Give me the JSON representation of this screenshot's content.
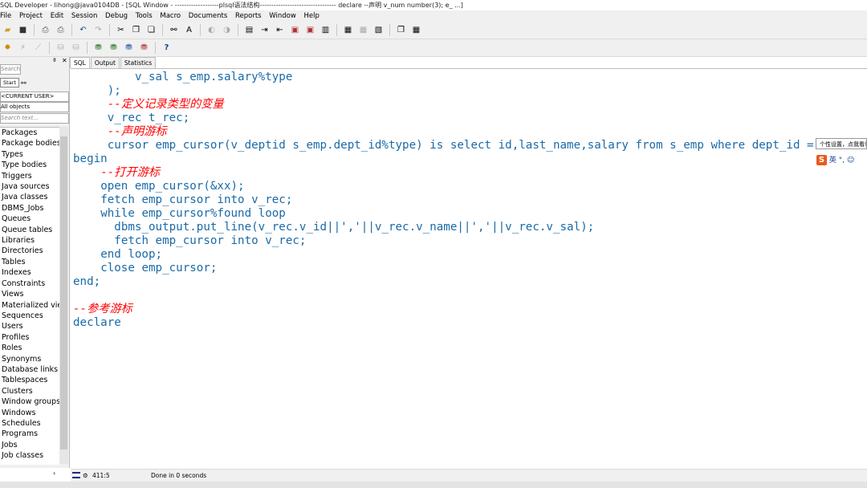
{
  "window": {
    "title": "SQL Developer - lihong@java0104DB - [SQL Window - -------------------plsql语法结构--------------------------------- declare --声明 v_num number(3); e_ ...]"
  },
  "menu": [
    "File",
    "Project",
    "Edit",
    "Session",
    "Debug",
    "Tools",
    "Macro",
    "Documents",
    "Reports",
    "Window",
    "Help"
  ],
  "left_panel": {
    "search_placeholder": "Search text...",
    "start_label": "Start",
    "user_combo": "<CURRENT USER>",
    "type_combo": "All objects",
    "object_types": [
      "Packages",
      "Package bodies",
      "Types",
      "Type bodies",
      "Triggers",
      "Java sources",
      "Java classes",
      "DBMS_Jobs",
      "Queues",
      "Queue tables",
      "Libraries",
      "Directories",
      "Tables",
      "Indexes",
      "Constraints",
      "Views",
      "Materialized views",
      "Sequences",
      "Users",
      "Profiles",
      "Roles",
      "Synonyms",
      "Database links",
      "Tablespaces",
      "Clusters",
      "Window groups",
      "Windows",
      "Schedules",
      "Programs",
      "Jobs",
      "Job classes"
    ]
  },
  "tabs": [
    "SQL",
    "Output",
    "Statistics"
  ],
  "editor": {
    "lines": [
      {
        "indent": 9,
        "segments": [
          {
            "t": "v_sal s_emp.salary%type",
            "c": "plain"
          }
        ]
      },
      {
        "indent": 5,
        "segments": [
          {
            "t": ");",
            "c": "plain"
          }
        ]
      },
      {
        "indent": 5,
        "segments": [
          {
            "t": "--定义记录类型的变量",
            "c": "cm"
          }
        ]
      },
      {
        "indent": 5,
        "segments": [
          {
            "t": "v_rec t_rec;",
            "c": "plain"
          }
        ]
      },
      {
        "indent": 5,
        "segments": [
          {
            "t": "--声明游标",
            "c": "cm"
          }
        ]
      },
      {
        "indent": 5,
        "segments": [
          {
            "t": "cursor emp_cursor(v_deptid s_emp.dept_id%type) ",
            "c": "plain"
          },
          {
            "t": "is select",
            "c": "kw"
          },
          {
            "t": " id,last_name,salary ",
            "c": "plain"
          },
          {
            "t": "from",
            "c": "kw"
          },
          {
            "t": " s_emp ",
            "c": "plain"
          },
          {
            "t": "where",
            "c": "kw"
          },
          {
            "t": " dept_id = ",
            "c": "plain"
          }
        ]
      },
      {
        "indent": 0,
        "segments": [
          {
            "t": "begin",
            "c": "kw"
          }
        ]
      },
      {
        "indent": 4,
        "segments": [
          {
            "t": "--打开游标",
            "c": "cm"
          }
        ]
      },
      {
        "indent": 4,
        "segments": [
          {
            "t": "open",
            "c": "kw"
          },
          {
            "t": " emp_cursor(&xx);",
            "c": "plain"
          }
        ]
      },
      {
        "indent": 4,
        "segments": [
          {
            "t": "fetch",
            "c": "kw"
          },
          {
            "t": " emp_cursor ",
            "c": "plain"
          },
          {
            "t": "into",
            "c": "kw"
          },
          {
            "t": " v_rec;",
            "c": "plain"
          }
        ]
      },
      {
        "indent": 4,
        "segments": [
          {
            "t": "while",
            "c": "kw"
          },
          {
            "t": " emp_cursor%found ",
            "c": "plain"
          },
          {
            "t": "loop",
            "c": "kw"
          }
        ]
      },
      {
        "indent": 6,
        "segments": [
          {
            "t": "dbms_output.put_line(v_rec.v_id||','||v_rec.v_name||','||v_rec.v_sal);",
            "c": "plain"
          }
        ]
      },
      {
        "indent": 6,
        "segments": [
          {
            "t": "fetch",
            "c": "kw"
          },
          {
            "t": " emp_cursor ",
            "c": "plain"
          },
          {
            "t": "into",
            "c": "kw"
          },
          {
            "t": " v_rec;",
            "c": "plain"
          }
        ]
      },
      {
        "indent": 4,
        "segments": [
          {
            "t": "end loop",
            "c": "kw"
          },
          {
            "t": ";",
            "c": "plain"
          }
        ]
      },
      {
        "indent": 4,
        "segments": [
          {
            "t": "close",
            "c": "kw"
          },
          {
            "t": " emp_cursor;",
            "c": "plain"
          }
        ]
      },
      {
        "indent": 0,
        "segments": [
          {
            "t": "end",
            "c": "kw"
          },
          {
            "t": ";",
            "c": "plain"
          }
        ]
      },
      {
        "indent": 0,
        "segments": [
          {
            "t": "",
            "c": "plain"
          }
        ]
      },
      {
        "indent": 0,
        "segments": [
          {
            "t": "--参考游标",
            "c": "cm"
          }
        ]
      },
      {
        "indent": 0,
        "segments": [
          {
            "t": "declare",
            "c": "plain"
          }
        ]
      }
    ]
  },
  "status": {
    "cursor_position": "411:5",
    "message": "Done in 0 seconds"
  },
  "ime": {
    "popup_text": "个性设置，点我看看",
    "lang_label": "英"
  },
  "colors": {
    "keyword": "#1a6aa8",
    "comment": "#ff0000",
    "menu_bg": "#f0f0f0"
  }
}
